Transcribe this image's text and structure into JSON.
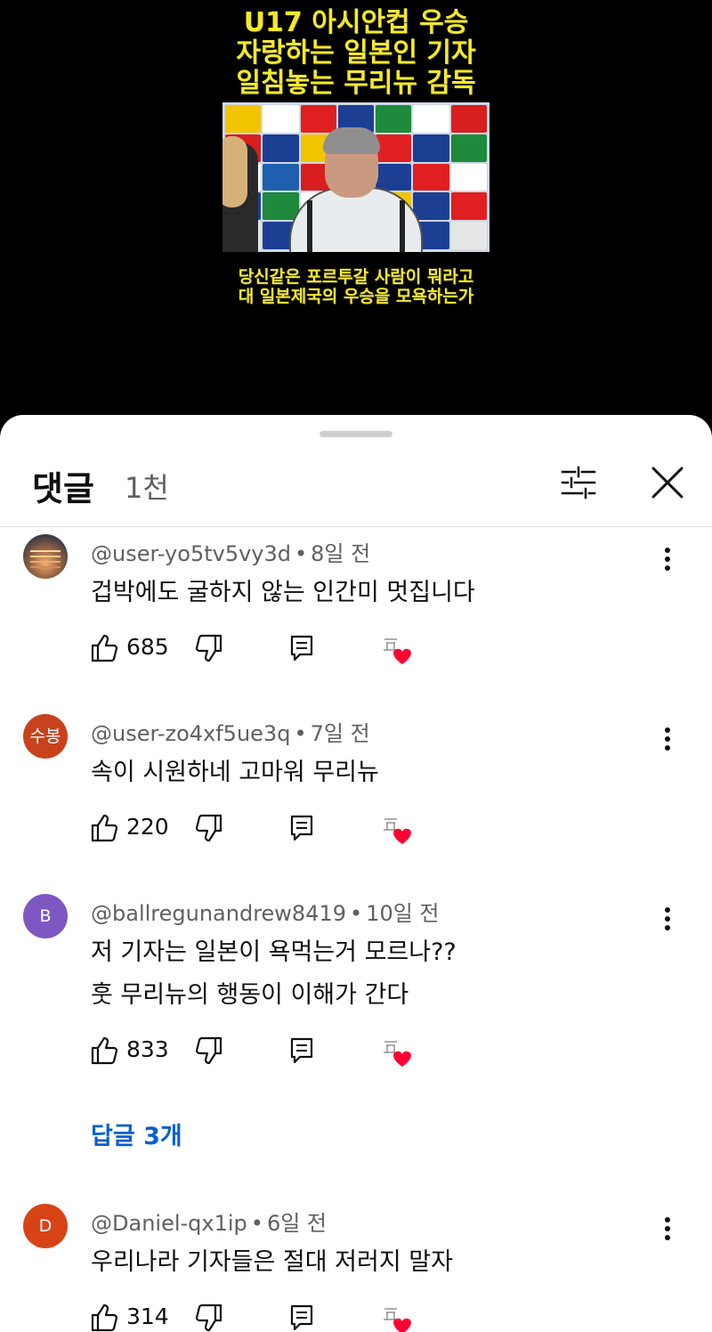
{
  "video": {
    "title_lines": [
      "U17 아시안컵 우승",
      "자랑하는 일본인 기자",
      "일침놓는 무리뉴 감독"
    ],
    "subtitle_lines": [
      "당신같은 포르투갈 사람이 뭐라고",
      "대 일본제국의 우승을 모욕하는가"
    ]
  },
  "sheet": {
    "title": "댓글",
    "count": "1천",
    "filter_icon": "filter-sliders-icon",
    "close_icon": "close-icon"
  },
  "comments": [
    {
      "author": "@user-yo5tv5vy3d",
      "time": "8일 전",
      "avatar_type": "photo",
      "avatar_text": "",
      "avatar_color": "#6b4b3a",
      "lines": [
        "겁박에도 굴하지 않는 인간미 멋집니다"
      ],
      "likes": "685"
    },
    {
      "author": "@user-zo4xf5ue3q",
      "time": "7일 전",
      "avatar_type": "text",
      "avatar_text": "수봉",
      "avatar_color": "#c8431d",
      "lines": [
        "속이 시원하네 고마워 무리뉴"
      ],
      "likes": "220"
    },
    {
      "author": "@ballregunandrew8419",
      "time": "10일 전",
      "avatar_type": "text",
      "avatar_text": "B",
      "avatar_color": "#7e57c2",
      "lines": [
        "저 기자는 일본이 욕먹는거 모르나??",
        "훗 무리뉴의 행동이 이해가 간다"
      ],
      "likes": "833",
      "replies_label": "답글 3개"
    },
    {
      "author": "@Daniel-qx1ip",
      "time": "6일 전",
      "avatar_type": "text",
      "avatar_text": "D",
      "avatar_color": "#d84315",
      "lines": [
        "우리나라 기자들은 절대 저러지 말자"
      ],
      "likes": "314"
    }
  ],
  "colors": {
    "title_yellow": "#f4e92a",
    "link_blue": "#065fd4",
    "heart_red": "#ff0033"
  }
}
